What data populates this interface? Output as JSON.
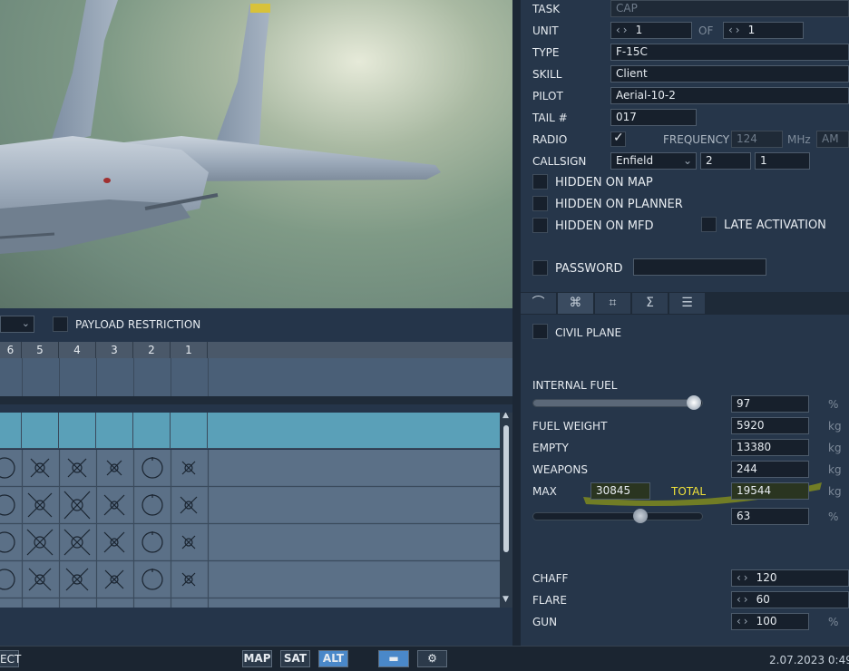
{
  "mission": {
    "task_label": "TASK",
    "task_value": "CAP",
    "unit_label": "UNIT",
    "unit_value": "1",
    "unit_of_label": "OF",
    "unit_of_value": "1",
    "type_label": "TYPE",
    "type_value": "F-15C",
    "skill_label": "SKILL",
    "skill_value": "Client",
    "pilot_label": "PILOT",
    "pilot_value": "Aerial-10-2",
    "tail_label": "TAIL #",
    "tail_value": "017",
    "radio_label": "RADIO",
    "radio_checked": true,
    "frequency_label": "FREQUENCY",
    "frequency_value": "124",
    "frequency_unit": "MHz",
    "modulation_value": "AM",
    "callsign_label": "CALLSIGN",
    "callsign_name": "Enfield",
    "callsign_num1": "2",
    "callsign_num2": "1",
    "hidden_map_label": "HIDDEN ON MAP",
    "hidden_planner_label": "HIDDEN ON PLANNER",
    "hidden_mfd_label": "HIDDEN ON MFD",
    "late_activation_label": "LATE ACTIVATION",
    "password_label": "PASSWORD",
    "password_value": ""
  },
  "tabs": {
    "icons": [
      "waypoint-icon",
      "payload-icon",
      "airframe-icon",
      "summary-icon",
      "datalink-icon"
    ],
    "glyphs": [
      "⌒",
      "⌘",
      "⌗",
      "Σ",
      "☰"
    ]
  },
  "payload": {
    "civil_plane_label": "CIVIL PLANE",
    "internal_fuel_label": "INTERNAL FUEL",
    "internal_fuel_value": "97",
    "internal_fuel_unit": "%",
    "internal_fuel_level": 0.97,
    "fuel_weight_label": "FUEL WEIGHT",
    "fuel_weight_value": "5920",
    "fuel_weight_unit": "kg",
    "empty_label": "EMPTY",
    "empty_value": "13380",
    "empty_unit": "kg",
    "weapons_label": "WEAPONS",
    "weapons_value": "244",
    "weapons_unit": "kg",
    "max_label": "MAX",
    "max_value": "30845",
    "total_label": "TOTAL",
    "total_value": "19544",
    "total_unit": "kg",
    "ammo_value": "63",
    "ammo_unit": "%",
    "ammo_level": 0.63,
    "chaff_label": "CHAFF",
    "chaff_value": "120",
    "flare_label": "FLARE",
    "flare_value": "60",
    "gun_label": "GUN",
    "gun_value": "100",
    "gun_unit": "%"
  },
  "loadout": {
    "payload_restriction_label": "PAYLOAD RESTRICTION",
    "stations": [
      "6",
      "5",
      "4",
      "3",
      "2",
      "1"
    ]
  },
  "statusbar": {
    "left_text": "ECT",
    "map_label": "MAP",
    "sat_label": "SAT",
    "alt_label": "ALT",
    "datetime": "2.07.2023 0:49"
  },
  "colors": {
    "accent_blue": "#4a88c9",
    "highlight_yellow": "#f0e23a",
    "selected_row": "#5aa0b8"
  }
}
